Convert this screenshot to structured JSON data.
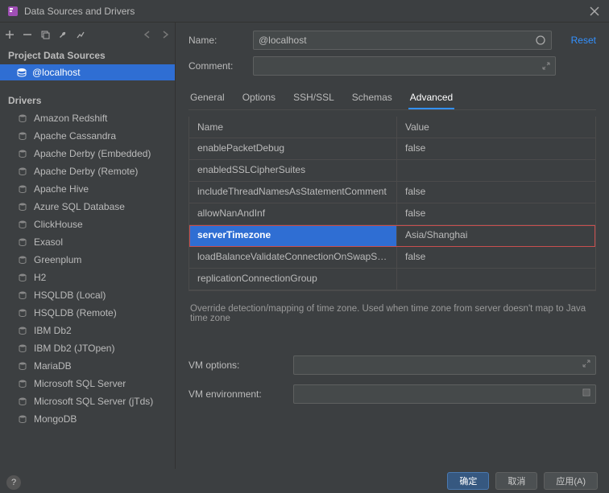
{
  "window": {
    "title": "Data Sources and Drivers"
  },
  "toolbar": {
    "icons": [
      "plus-icon",
      "minus-icon",
      "copy-icon",
      "wrench-icon",
      "chart-icon",
      "arrow-left-icon",
      "arrow-right-icon"
    ]
  },
  "sidebar": {
    "project_header": "Project Data Sources",
    "data_sources": [
      {
        "label": "@localhost",
        "selected": true
      }
    ],
    "drivers_header": "Drivers",
    "drivers": [
      "Amazon Redshift",
      "Apache Cassandra",
      "Apache Derby (Embedded)",
      "Apache Derby (Remote)",
      "Apache Hive",
      "Azure SQL Database",
      "ClickHouse",
      "Exasol",
      "Greenplum",
      "H2",
      "HSQLDB (Local)",
      "HSQLDB (Remote)",
      "IBM Db2",
      "IBM Db2 (JTOpen)",
      "MariaDB",
      "Microsoft SQL Server",
      "Microsoft SQL Server (jTds)",
      "MongoDB"
    ]
  },
  "content": {
    "name_label": "Name:",
    "name_value": "@localhost",
    "comment_label": "Comment:",
    "comment_value": "",
    "reset_label": "Reset",
    "tabs": [
      "General",
      "Options",
      "SSH/SSL",
      "Schemas",
      "Advanced"
    ],
    "active_tab_index": 4,
    "prop_header_name": "Name",
    "prop_header_value": "Value",
    "properties": [
      {
        "name": "enablePacketDebug",
        "value": "false",
        "selected": false
      },
      {
        "name": "enabledSSLCipherSuites",
        "value": "",
        "selected": false
      },
      {
        "name": "includeThreadNamesAsStatementComment",
        "value": "false",
        "selected": false
      },
      {
        "name": "allowNanAndInf",
        "value": "false",
        "selected": false
      },
      {
        "name": "serverTimezone",
        "value": "Asia/Shanghai",
        "selected": true
      },
      {
        "name": "loadBalanceValidateConnectionOnSwapServ…",
        "value": "false",
        "selected": false
      },
      {
        "name": "replicationConnectionGroup",
        "value": "",
        "selected": false
      }
    ],
    "hint": "Override detection/mapping of time zone. Used when time zone from server doesn't map to Java time zone",
    "vm_options_label": "VM options:",
    "vm_options_value": "",
    "vm_env_label": "VM environment:",
    "vm_env_value": ""
  },
  "footer": {
    "help_badge": "?",
    "ok_label": "确定",
    "cancel_label": "取消",
    "apply_label": "应用(A)"
  }
}
